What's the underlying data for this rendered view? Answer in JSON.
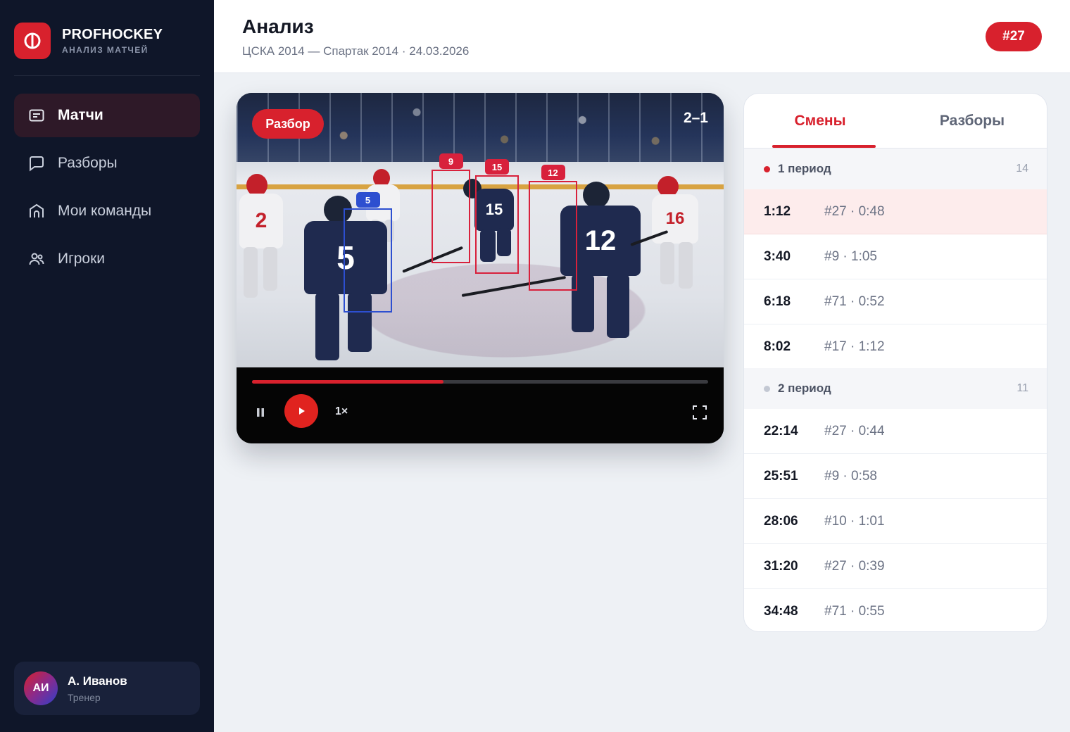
{
  "brand": {
    "name": "PROFHOCKEY",
    "subtitle": "АНАЛИЗ МАТЧЕЙ"
  },
  "nav": [
    {
      "label": "Матчи",
      "icon": "matches-icon",
      "active": true
    },
    {
      "label": "Разборы",
      "icon": "chat-icon",
      "active": false
    },
    {
      "label": "Мои команды",
      "icon": "arena-icon",
      "active": false
    },
    {
      "label": "Игроки",
      "icon": "players-icon",
      "active": false
    }
  ],
  "user": {
    "initials": "АИ",
    "name": "А. Иванов",
    "role": "Тренер"
  },
  "header": {
    "title": "Анализ",
    "subtitle": "ЦСКА 2014 — Спартак 2014 · 24.03.2026",
    "badge": "#27"
  },
  "video": {
    "tag": "Разбор",
    "score": "2–1",
    "progress": 0.42,
    "speed": "1×",
    "detections": [
      {
        "number": "5",
        "team": "blue"
      },
      {
        "number": "9",
        "team": "red"
      },
      {
        "number": "15",
        "team": "red"
      },
      {
        "number": "12",
        "team": "red"
      }
    ],
    "jerseys": {
      "left_white": "2",
      "right_white": "16",
      "dark_front": "5",
      "dark_right": "12",
      "dark_skater": "15"
    }
  },
  "panel": {
    "tabs": [
      {
        "label": "Смены",
        "active": true
      },
      {
        "label": "Разборы",
        "active": false
      }
    ],
    "periods": [
      {
        "label": "1 период",
        "count": "14",
        "dot_color": "#d8212d",
        "shifts": [
          {
            "time": "1:12",
            "meta": "#27 · 0:48",
            "active": true
          },
          {
            "time": "3:40",
            "meta": "#9 · 1:05",
            "active": false
          },
          {
            "time": "6:18",
            "meta": "#71 · 0:52",
            "active": false
          },
          {
            "time": "8:02",
            "meta": "#17 · 1:12",
            "active": false
          }
        ]
      },
      {
        "label": "2 период",
        "count": "11",
        "dot_color": "#c3c8d3",
        "shifts": [
          {
            "time": "22:14",
            "meta": "#27 · 0:44",
            "active": false
          },
          {
            "time": "25:51",
            "meta": "#9 · 0:58",
            "active": false
          },
          {
            "time": "28:06",
            "meta": "#10 · 1:01",
            "active": false
          },
          {
            "time": "31:20",
            "meta": "#27 · 0:39",
            "active": false
          },
          {
            "time": "34:48",
            "meta": "#71 · 0:55",
            "active": false
          }
        ]
      }
    ]
  },
  "colors": {
    "accent": "#d8212d",
    "sidebar": "#0f1629",
    "detection_red": "#d8213c",
    "detection_blue": "#2d4fd0"
  }
}
